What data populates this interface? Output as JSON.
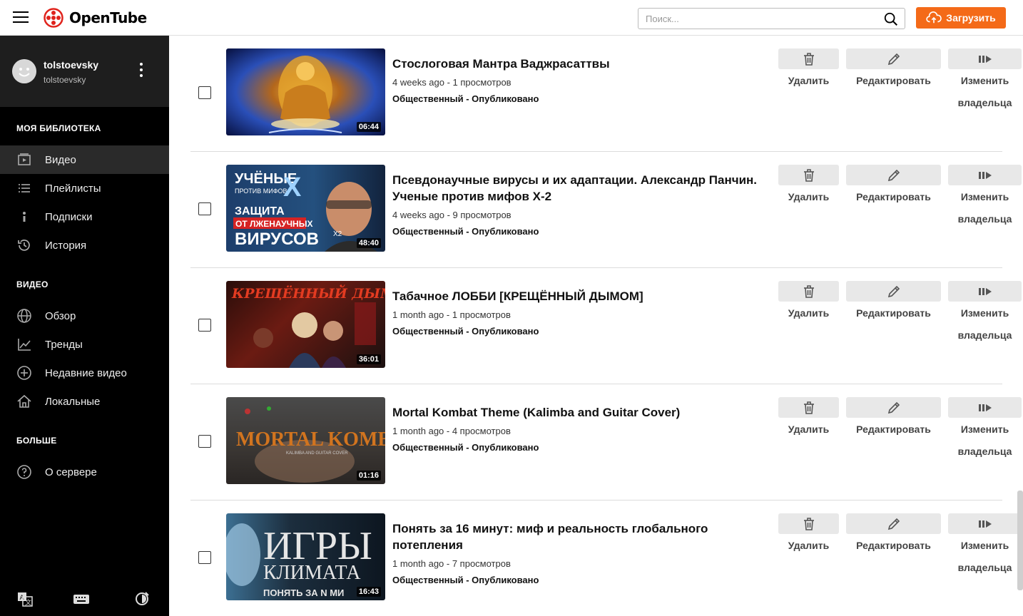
{
  "header": {
    "logo_text": "OpenTube",
    "search_placeholder": "Поиск...",
    "upload_label": "Загрузить"
  },
  "user": {
    "name": "tolstoevsky",
    "handle": "tolstoevsky"
  },
  "sidebar": {
    "library_title": "МОЯ БИБЛИОТЕКА",
    "library_items": [
      {
        "label": "Видео",
        "icon": "video-icon",
        "active": true
      },
      {
        "label": "Плейлисты",
        "icon": "playlist-icon"
      },
      {
        "label": "Подписки",
        "icon": "subscriptions-icon"
      },
      {
        "label": "История",
        "icon": "history-icon"
      }
    ],
    "video_title": "ВИДЕО",
    "video_items": [
      {
        "label": "Обзор",
        "icon": "globe-icon"
      },
      {
        "label": "Тренды",
        "icon": "trending-icon"
      },
      {
        "label": "Недавние видео",
        "icon": "plus-circle-icon"
      },
      {
        "label": "Локальные",
        "icon": "home-icon"
      }
    ],
    "more_title": "БОЛЬШЕ",
    "more_items": [
      {
        "label": "О сервере",
        "icon": "help-icon"
      }
    ]
  },
  "actions": {
    "delete": "Удалить",
    "edit": "Редактировать",
    "owner_line1": "Изменить",
    "owner_line2": "владельца"
  },
  "videos": [
    {
      "title": "Стослоговая Мантра Ваджрасаттвы",
      "meta": "4 weeks ago - 1 просмотров",
      "status": "Общественный - Опубликовано",
      "duration": "06:44"
    },
    {
      "title": "Псевдонаучные вирусы и их адаптации. Александр Панчин. Ученые против мифов X-2",
      "meta": "4 weeks ago - 9 просмотров",
      "status": "Общественный - Опубликовано",
      "duration": "48:40",
      "thumb_text": [
        "УЧЁНЫЕ",
        "ПРОТИВ МИФОВ",
        "X",
        "ЗАЩИТА",
        "ОТ ЛЖЕНАУЧНЫХ",
        "ВИРУСОВ",
        "X2"
      ]
    },
    {
      "title": "Табачное ЛОББИ [КРЕЩЁННЫЙ ДЫМОМ]",
      "meta": "1 month ago - 1 просмотров",
      "status": "Общественный - Опубликовано",
      "duration": "36:01",
      "thumb_text": [
        "КРЕЩЁННЫЙ ДЫМОМ"
      ]
    },
    {
      "title": "Mortal Kombat Theme (Kalimba and Guitar Cover)",
      "meta": "1 month ago - 4 просмотров",
      "status": "Общественный - Опубликовано",
      "duration": "01:16",
      "thumb_text": [
        "MORTAL KOMBAT",
        "KALIMBA AND GUITAR COVER"
      ]
    },
    {
      "title": "Понять за 16 минут: миф и реальность глобального потепления",
      "meta": "1 month ago - 7 просмотров",
      "status": "Общественный - Опубликовано",
      "duration": "16:43",
      "thumb_text": [
        "ИГРЫ",
        "КЛИМАТА",
        "ПОНЯТЬ ЗА N МИ"
      ]
    }
  ],
  "colors": {
    "accent": "#f46a18",
    "sidebar_bg": "#000000",
    "user_box_bg": "#1e1e1e",
    "button_bg": "#e8e8e8"
  }
}
